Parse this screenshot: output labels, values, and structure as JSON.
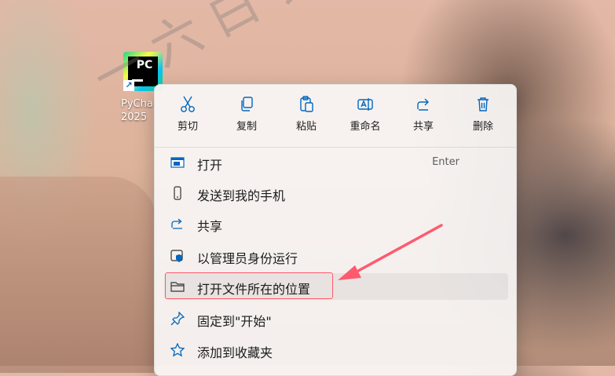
{
  "desktop_icon": {
    "label_line1": "PyCha",
    "label_line2": "2025"
  },
  "quick_actions": [
    {
      "label": "剪切",
      "icon": "scissors-icon"
    },
    {
      "label": "复制",
      "icon": "copy-icon"
    },
    {
      "label": "粘贴",
      "icon": "paste-icon"
    },
    {
      "label": "重命名",
      "icon": "rename-icon"
    },
    {
      "label": "共享",
      "icon": "share-icon"
    },
    {
      "label": "删除",
      "icon": "trash-icon"
    }
  ],
  "menu_items": [
    {
      "label": "打开",
      "accelerator": "Enter",
      "icon": "open-window-icon"
    },
    {
      "label": "发送到我的手机",
      "icon": "phone-icon"
    },
    {
      "label": "共享",
      "icon": "share-icon"
    },
    {
      "label": "以管理员身份运行",
      "icon": "shield-icon"
    },
    {
      "label": "打开文件所在的位置",
      "icon": "folder-icon"
    },
    {
      "label": "固定到\"开始\"",
      "icon": "pin-icon"
    },
    {
      "label": "添加到收藏夹",
      "icon": "star-icon"
    }
  ],
  "watermark": "一六白衣丰阁",
  "colors": {
    "accent": "#0067c0",
    "annotation": "#ff5a6e"
  }
}
